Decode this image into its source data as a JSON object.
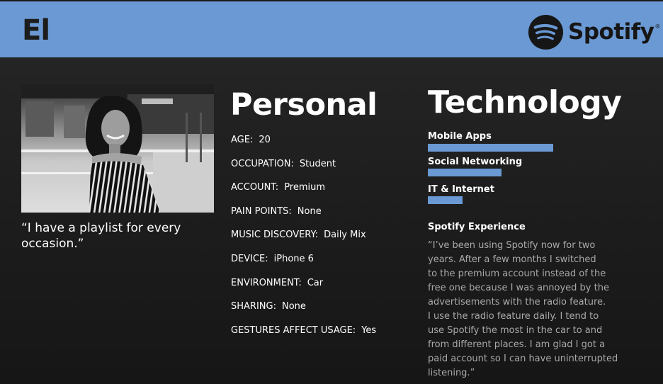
{
  "header": {
    "persona_name": "El",
    "brand_name": "Spotify",
    "brand_registered": "®",
    "background": "#6a99d3"
  },
  "persona": {
    "photo_icon": "persona-photo",
    "quote": "“I have a playlist for every occasion.”"
  },
  "personal": {
    "title": "Personal",
    "rows": [
      {
        "label": "AGE:",
        "value": "20"
      },
      {
        "label": "OCCUPATION:",
        "value": "Student"
      },
      {
        "label": "ACCOUNT:",
        "value": "Premium"
      },
      {
        "label": "PAIN POINTS:",
        "value": "None"
      },
      {
        "label": "MUSIC DISCOVERY:",
        "value": "Daily Mix"
      },
      {
        "label": "DEVICE:",
        "value": "iPhone 6"
      },
      {
        "label": "ENVIRONMENT:",
        "value": "Car"
      },
      {
        "label": "SHARING:",
        "value": "None"
      },
      {
        "label": "GESTURES AFFECT USAGE:",
        "value": "Yes"
      }
    ]
  },
  "technology": {
    "title": "Technology",
    "bar_color": "#6a99d3",
    "skills": [
      {
        "label": "Mobile Apps",
        "level": 0.68
      },
      {
        "label": "Social Networking",
        "level": 0.4
      },
      {
        "label": "IT & Internet",
        "level": 0.19
      }
    ]
  },
  "experience": {
    "title": "Spotify Experience",
    "lines": [
      "“I’ve been using Spotify now for two",
      "years. After a few months I switched",
      "to the premium account instead of the",
      "free one because I was annoyed by the",
      "advertisements with the radio feature.",
      "I use the radio feature daily. I tend to",
      "use Spotify the most in the car to and",
      "from different places. I am glad I got a",
      "paid account so I can have uninterrupted",
      "listening.”"
    ]
  }
}
